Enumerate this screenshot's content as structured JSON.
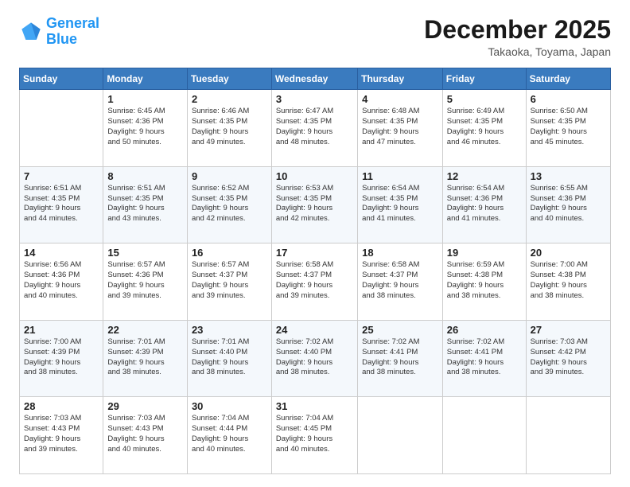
{
  "header": {
    "logo_line1": "General",
    "logo_line2": "Blue",
    "title": "December 2025",
    "subtitle": "Takaoka, Toyama, Japan"
  },
  "calendar": {
    "columns": [
      "Sunday",
      "Monday",
      "Tuesday",
      "Wednesday",
      "Thursday",
      "Friday",
      "Saturday"
    ],
    "weeks": [
      [
        {
          "day": "",
          "info": ""
        },
        {
          "day": "1",
          "info": "Sunrise: 6:45 AM\nSunset: 4:36 PM\nDaylight: 9 hours\nand 50 minutes."
        },
        {
          "day": "2",
          "info": "Sunrise: 6:46 AM\nSunset: 4:35 PM\nDaylight: 9 hours\nand 49 minutes."
        },
        {
          "day": "3",
          "info": "Sunrise: 6:47 AM\nSunset: 4:35 PM\nDaylight: 9 hours\nand 48 minutes."
        },
        {
          "day": "4",
          "info": "Sunrise: 6:48 AM\nSunset: 4:35 PM\nDaylight: 9 hours\nand 47 minutes."
        },
        {
          "day": "5",
          "info": "Sunrise: 6:49 AM\nSunset: 4:35 PM\nDaylight: 9 hours\nand 46 minutes."
        },
        {
          "day": "6",
          "info": "Sunrise: 6:50 AM\nSunset: 4:35 PM\nDaylight: 9 hours\nand 45 minutes."
        }
      ],
      [
        {
          "day": "7",
          "info": "Sunrise: 6:51 AM\nSunset: 4:35 PM\nDaylight: 9 hours\nand 44 minutes."
        },
        {
          "day": "8",
          "info": "Sunrise: 6:51 AM\nSunset: 4:35 PM\nDaylight: 9 hours\nand 43 minutes."
        },
        {
          "day": "9",
          "info": "Sunrise: 6:52 AM\nSunset: 4:35 PM\nDaylight: 9 hours\nand 42 minutes."
        },
        {
          "day": "10",
          "info": "Sunrise: 6:53 AM\nSunset: 4:35 PM\nDaylight: 9 hours\nand 42 minutes."
        },
        {
          "day": "11",
          "info": "Sunrise: 6:54 AM\nSunset: 4:35 PM\nDaylight: 9 hours\nand 41 minutes."
        },
        {
          "day": "12",
          "info": "Sunrise: 6:54 AM\nSunset: 4:36 PM\nDaylight: 9 hours\nand 41 minutes."
        },
        {
          "day": "13",
          "info": "Sunrise: 6:55 AM\nSunset: 4:36 PM\nDaylight: 9 hours\nand 40 minutes."
        }
      ],
      [
        {
          "day": "14",
          "info": "Sunrise: 6:56 AM\nSunset: 4:36 PM\nDaylight: 9 hours\nand 40 minutes."
        },
        {
          "day": "15",
          "info": "Sunrise: 6:57 AM\nSunset: 4:36 PM\nDaylight: 9 hours\nand 39 minutes."
        },
        {
          "day": "16",
          "info": "Sunrise: 6:57 AM\nSunset: 4:37 PM\nDaylight: 9 hours\nand 39 minutes."
        },
        {
          "day": "17",
          "info": "Sunrise: 6:58 AM\nSunset: 4:37 PM\nDaylight: 9 hours\nand 39 minutes."
        },
        {
          "day": "18",
          "info": "Sunrise: 6:58 AM\nSunset: 4:37 PM\nDaylight: 9 hours\nand 38 minutes."
        },
        {
          "day": "19",
          "info": "Sunrise: 6:59 AM\nSunset: 4:38 PM\nDaylight: 9 hours\nand 38 minutes."
        },
        {
          "day": "20",
          "info": "Sunrise: 7:00 AM\nSunset: 4:38 PM\nDaylight: 9 hours\nand 38 minutes."
        }
      ],
      [
        {
          "day": "21",
          "info": "Sunrise: 7:00 AM\nSunset: 4:39 PM\nDaylight: 9 hours\nand 38 minutes."
        },
        {
          "day": "22",
          "info": "Sunrise: 7:01 AM\nSunset: 4:39 PM\nDaylight: 9 hours\nand 38 minutes."
        },
        {
          "day": "23",
          "info": "Sunrise: 7:01 AM\nSunset: 4:40 PM\nDaylight: 9 hours\nand 38 minutes."
        },
        {
          "day": "24",
          "info": "Sunrise: 7:02 AM\nSunset: 4:40 PM\nDaylight: 9 hours\nand 38 minutes."
        },
        {
          "day": "25",
          "info": "Sunrise: 7:02 AM\nSunset: 4:41 PM\nDaylight: 9 hours\nand 38 minutes."
        },
        {
          "day": "26",
          "info": "Sunrise: 7:02 AM\nSunset: 4:41 PM\nDaylight: 9 hours\nand 38 minutes."
        },
        {
          "day": "27",
          "info": "Sunrise: 7:03 AM\nSunset: 4:42 PM\nDaylight: 9 hours\nand 39 minutes."
        }
      ],
      [
        {
          "day": "28",
          "info": "Sunrise: 7:03 AM\nSunset: 4:43 PM\nDaylight: 9 hours\nand 39 minutes."
        },
        {
          "day": "29",
          "info": "Sunrise: 7:03 AM\nSunset: 4:43 PM\nDaylight: 9 hours\nand 40 minutes."
        },
        {
          "day": "30",
          "info": "Sunrise: 7:04 AM\nSunset: 4:44 PM\nDaylight: 9 hours\nand 40 minutes."
        },
        {
          "day": "31",
          "info": "Sunrise: 7:04 AM\nSunset: 4:45 PM\nDaylight: 9 hours\nand 40 minutes."
        },
        {
          "day": "",
          "info": ""
        },
        {
          "day": "",
          "info": ""
        },
        {
          "day": "",
          "info": ""
        }
      ]
    ]
  }
}
